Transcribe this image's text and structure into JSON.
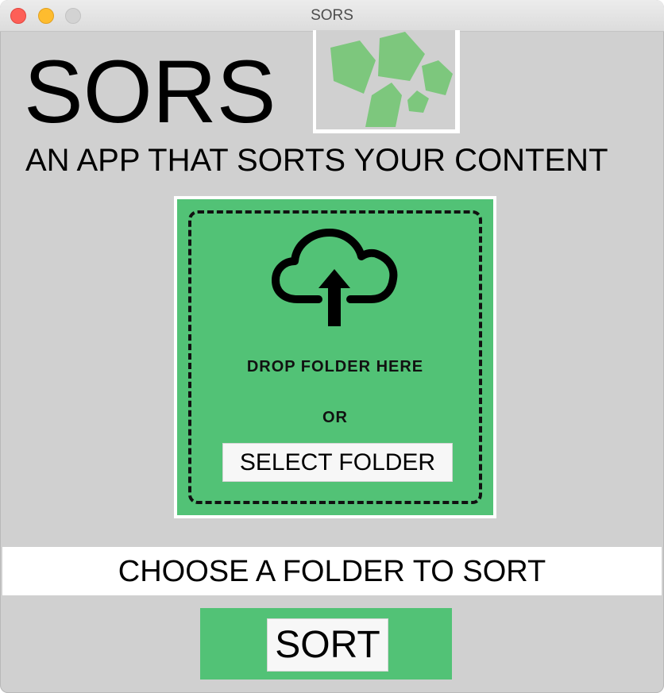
{
  "window": {
    "title": "SORS",
    "controls": [
      "close",
      "minimize",
      "maximize"
    ]
  },
  "header": {
    "app_name": "SORS",
    "tagline": "AN APP THAT SORTS YOUR CONTENT",
    "logo_icon": "pentagons-logo-icon"
  },
  "dropzone": {
    "icon": "cloud-upload-icon",
    "drop_label": "DROP FOLDER HERE",
    "or_label": "OR",
    "select_button_label": "SELECT FOLDER"
  },
  "status": {
    "message": "CHOOSE A FOLDER TO SORT"
  },
  "actions": {
    "sort_button_label": "SORT"
  },
  "colors": {
    "accent_green": "#52c276",
    "logo_green": "#7dc77d",
    "background": "#d0d0d0"
  }
}
